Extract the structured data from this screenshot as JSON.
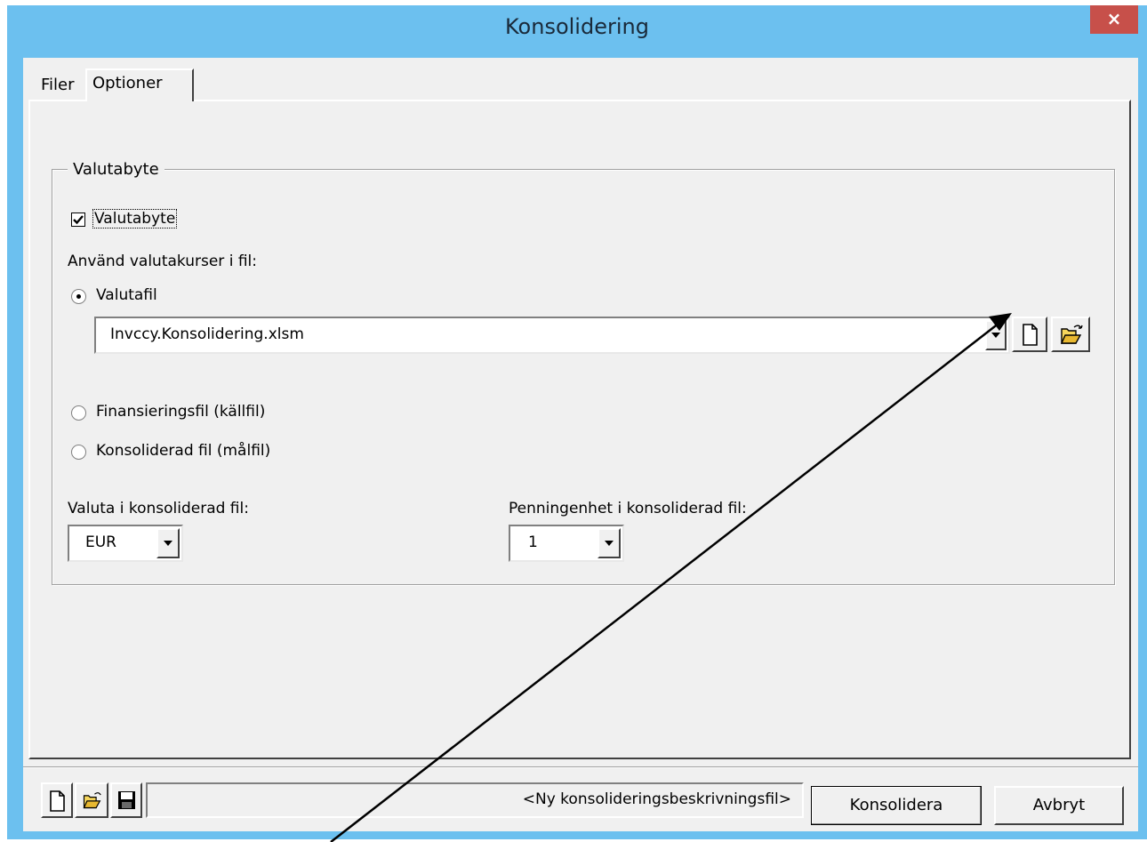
{
  "window": {
    "title": "Konsolidering",
    "close_label": "×"
  },
  "tabs": [
    {
      "label": "Filer"
    },
    {
      "label": "Optioner"
    }
  ],
  "options": {
    "group_label": "Valutabyte",
    "checkbox_label": "Valutabyte",
    "checkbox_checked": true,
    "rates_label": "Använd valutakurser i fil:",
    "radio_currency_file": "Valutafil",
    "currency_file_value": "Invccy.Konsolidering.xlsm",
    "radio_financing_file": "Finansieringsfil (källfil)",
    "radio_consolidated_file": "Konsoliderad fil (målfil)",
    "selected_radio": "Valutafil",
    "currency_label": "Valuta i konsoliderad fil:",
    "currency_value": "EUR",
    "unit_label": "Penningenhet i konsoliderad fil:",
    "unit_value": "1"
  },
  "footer": {
    "description_file": "<Ny konsolideringsbeskrivningsfil>",
    "consolidate_label": "Konsolidera",
    "cancel_label": "Avbryt"
  },
  "icons": [
    "new-file-icon",
    "open-folder-icon",
    "save-icon",
    "chevron-down-icon",
    "close-icon"
  ]
}
